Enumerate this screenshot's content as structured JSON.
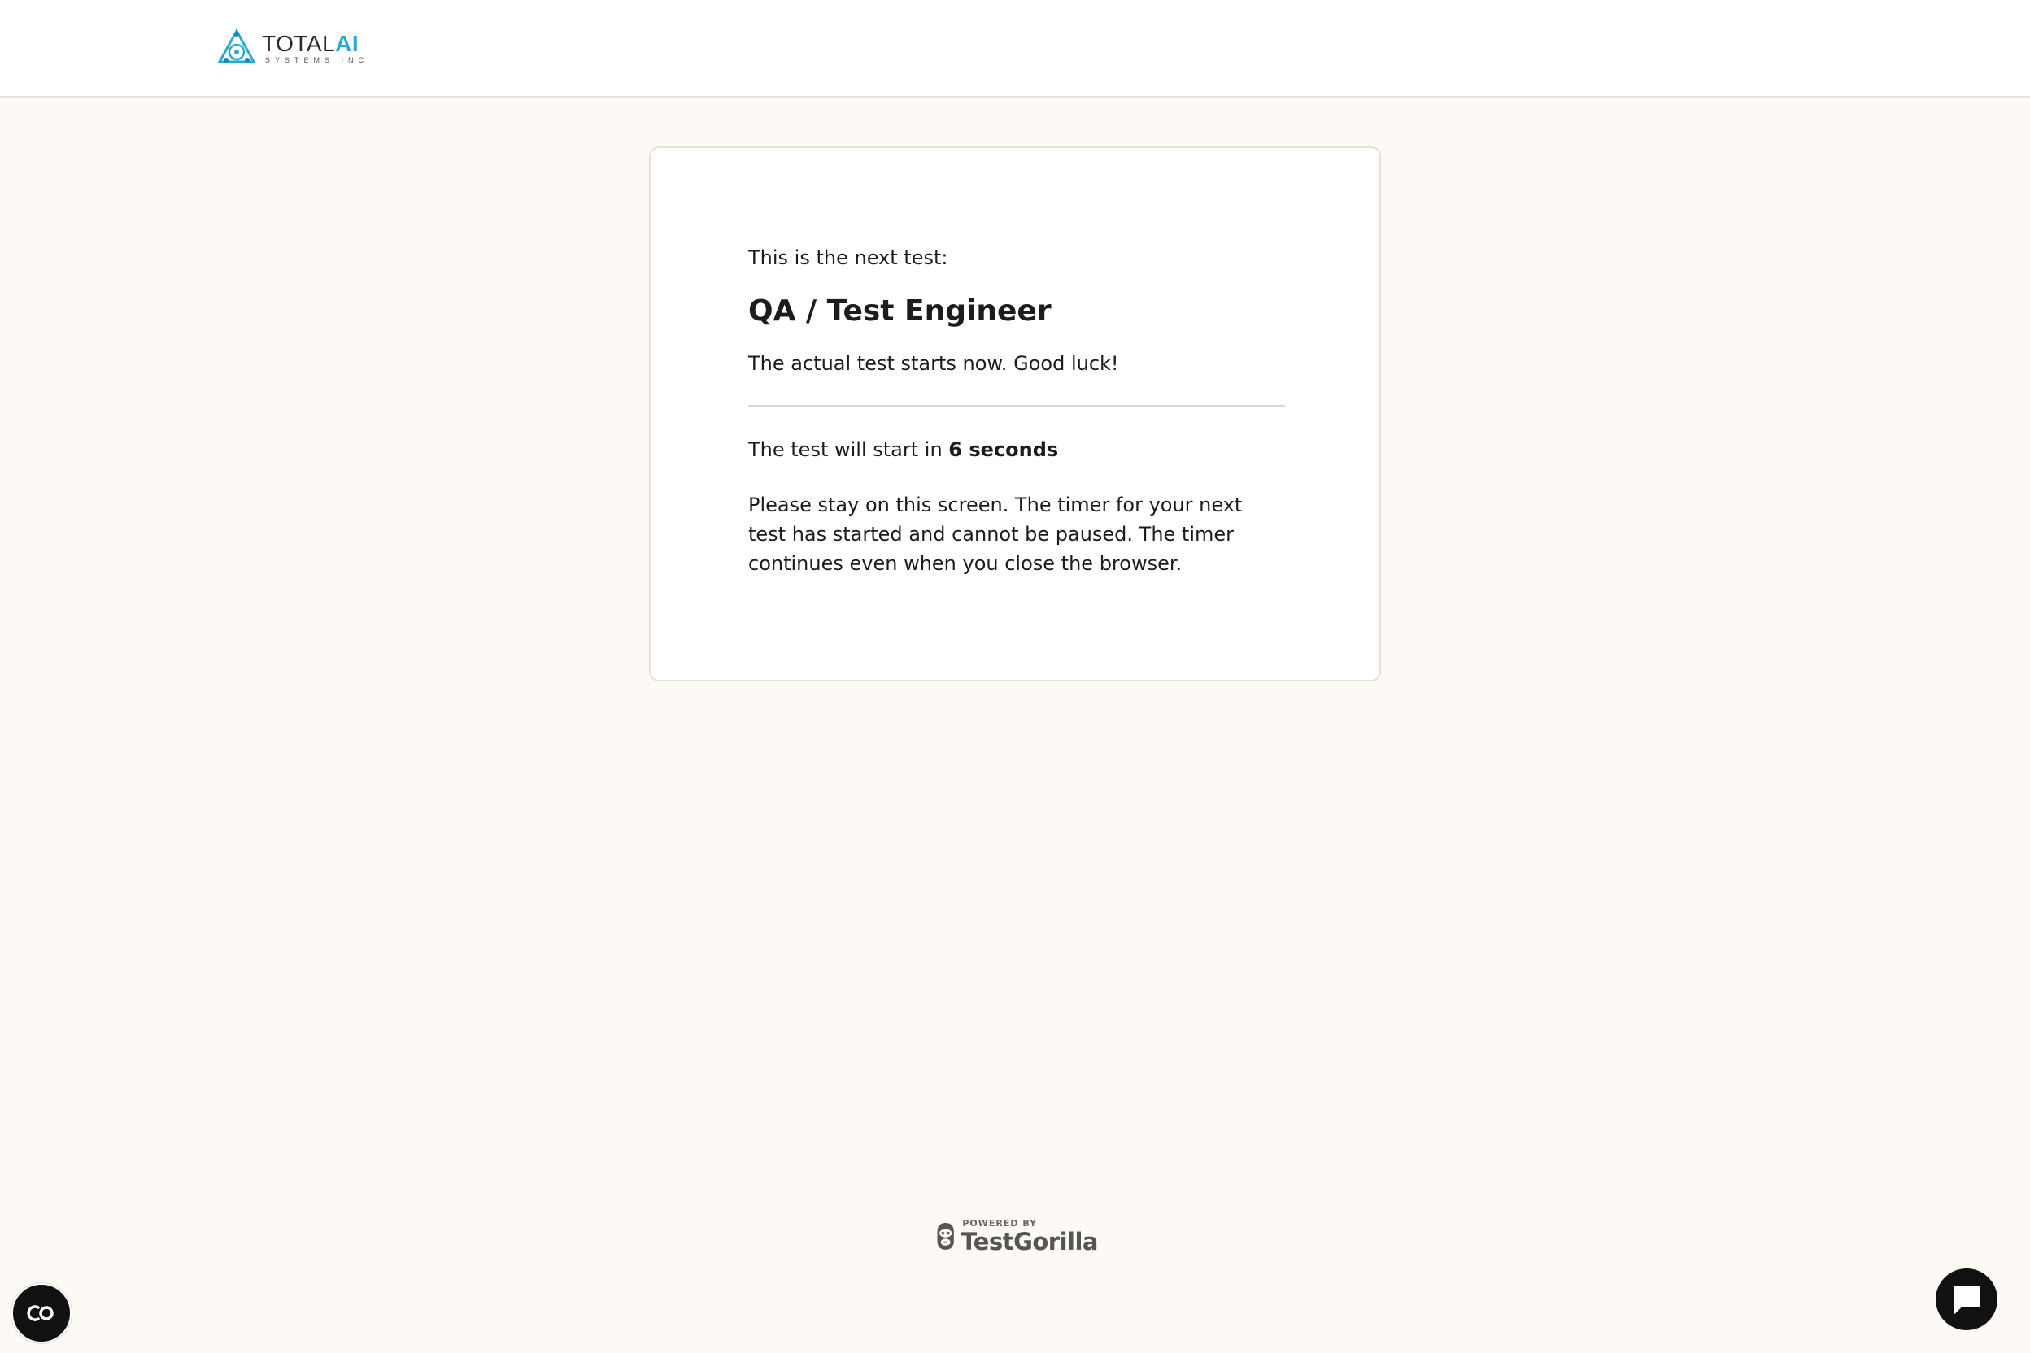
{
  "header": {
    "logo_main": "TOTAL",
    "logo_ai": "AI",
    "logo_sub": "SYSTEMS INC"
  },
  "card": {
    "intro": "This is the next test:",
    "test_title": "QA / Test Engineer",
    "good_luck": "The actual test starts now. Good luck!",
    "countdown_prefix": "The test will start in",
    "countdown_value": "6 seconds",
    "stay_message": "Please stay on this screen. The timer for your next test has started and cannot be paused. The timer continues even when you close the browser."
  },
  "footer": {
    "powered_by": "POWERED BY",
    "brand": "TestGorilla"
  },
  "widgets": {
    "accessibility_icon": "cc-icon",
    "chat_icon": "chat-icon"
  },
  "colors": {
    "background": "#fdf9f5",
    "header_bg": "#ffffff",
    "accent_ai": "#2aa9d6",
    "button_dark": "#111111"
  }
}
